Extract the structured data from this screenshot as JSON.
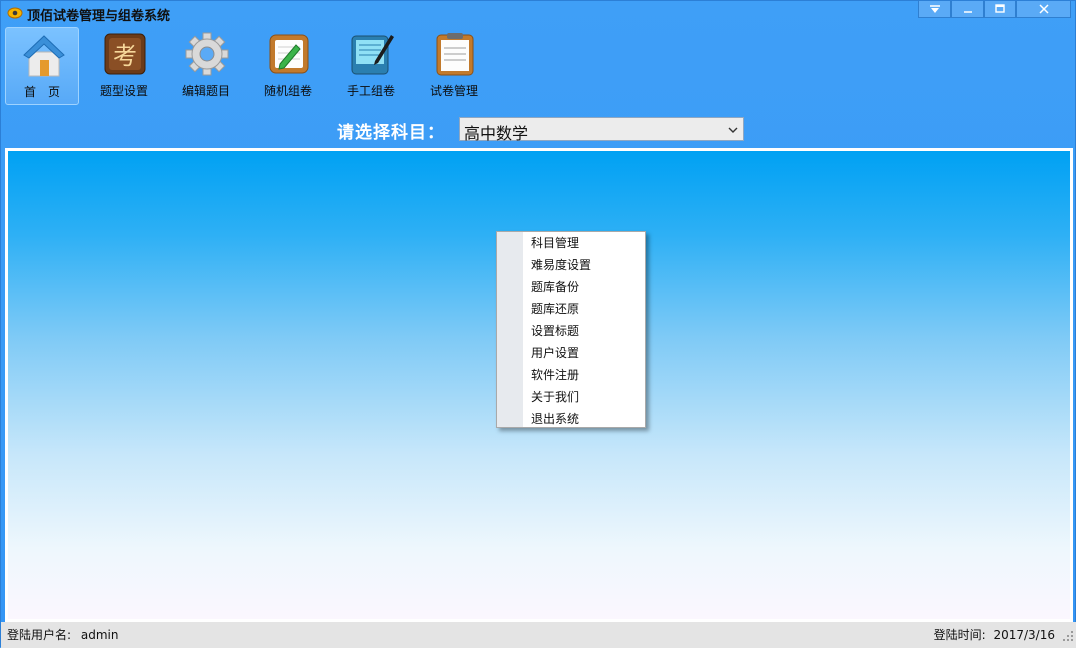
{
  "window": {
    "title": "顶佰试卷管理与组卷系统",
    "accent": "#3d9cf5"
  },
  "toolbar": {
    "items": [
      {
        "label": "首　页",
        "icon": "home-icon",
        "active": true
      },
      {
        "label": "题型设置",
        "icon": "exam-book-icon",
        "active": false
      },
      {
        "label": "编辑题目",
        "icon": "gear-icon",
        "active": false
      },
      {
        "label": "随机组卷",
        "icon": "notepad-pencil-icon",
        "active": false
      },
      {
        "label": "手工组卷",
        "icon": "tablet-pen-icon",
        "active": false
      },
      {
        "label": "试卷管理",
        "icon": "clipboard-icon",
        "active": false
      }
    ]
  },
  "subject": {
    "label": "请选择科目：",
    "selected": "高中数学"
  },
  "context_menu": {
    "items": [
      "科目管理",
      "难易度设置",
      "题库备份",
      "题库还原",
      "设置标题",
      "用户设置",
      "软件注册",
      "关于我们",
      "退出系统"
    ]
  },
  "status": {
    "user_label": "登陆用户名:",
    "user_value": "admin",
    "time_label": "登陆时间:",
    "time_value": "2017/3/16"
  }
}
